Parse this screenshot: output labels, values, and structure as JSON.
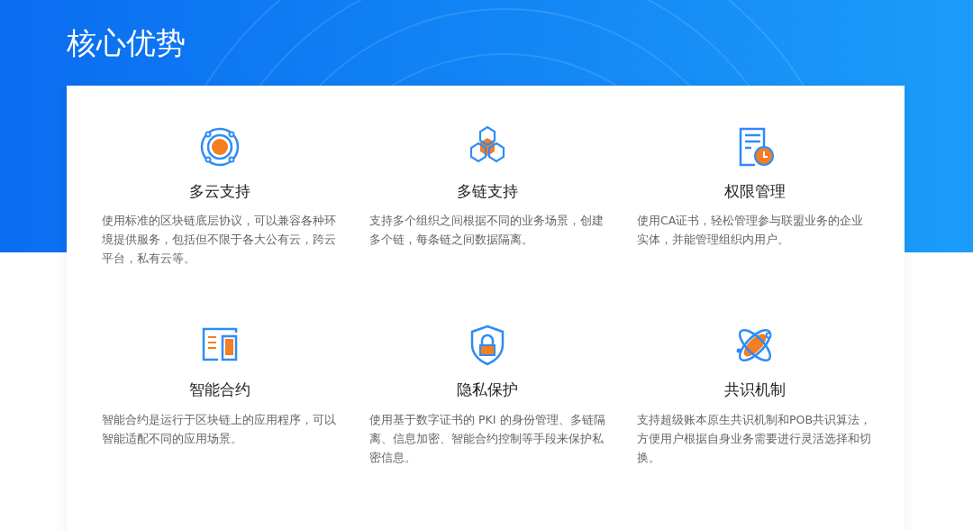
{
  "title": "核心优势",
  "features": [
    {
      "kind": "cloud",
      "title": "多云支持",
      "description": "使用标准的区块链底层协议，可以兼容各种环境提供服务，包括但不限于各大公有云，跨云平台，私有云等。"
    },
    {
      "kind": "chain",
      "title": "多链支持",
      "description": "支持多个组织之间根据不同的业务场景，创建多个链，每条链之间数据隔离。"
    },
    {
      "kind": "permission",
      "title": "权限管理",
      "description": "使用CA证书，轻松管理参与联盟业务的企业实体，并能管理组织内用户。"
    },
    {
      "kind": "contract",
      "title": "智能合约",
      "description": "智能合约是运行于区块链上的应用程序，可以智能适配不同的应用场景。"
    },
    {
      "kind": "privacy",
      "title": "隐私保护",
      "description": "使用基于数字证书的 PKI 的身份管理、多链隔离、信息加密、智能合约控制等手段来保护私密信息。"
    },
    {
      "kind": "consensus",
      "title": "共识机制",
      "description": "支持超级账本原生共识机制和POB共识算法，方便用户根据自身业务需要进行灵活选择和切换。"
    }
  ]
}
